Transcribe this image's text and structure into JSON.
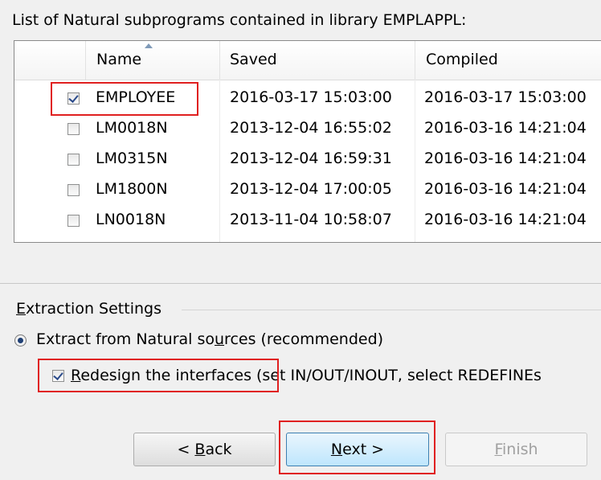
{
  "list": {
    "title": "List of Natural subprograms contained in library EMPLAPPL:",
    "columns": {
      "name": "Name",
      "saved": "Saved",
      "compiled": "Compiled"
    },
    "rows": [
      {
        "name": "EMPLOYEE",
        "saved": "2016-03-17 15:03:00",
        "compiled": "2016-03-17 15:03:00",
        "checked": true
      },
      {
        "name": "LM0018N",
        "saved": "2013-12-04 16:55:02",
        "compiled": "2016-03-16 14:21:04",
        "checked": false
      },
      {
        "name": "LM0315N",
        "saved": "2013-12-04 16:59:31",
        "compiled": "2016-03-16 14:21:04",
        "checked": false
      },
      {
        "name": "LM1800N",
        "saved": "2013-12-04 17:00:05",
        "compiled": "2016-03-16 14:21:04",
        "checked": false
      },
      {
        "name": "LN0018N",
        "saved": "2013-11-04 10:58:07",
        "compiled": "2016-03-16 14:21:04",
        "checked": false
      }
    ]
  },
  "settings": {
    "group_title_pre": "E",
    "group_title_post": "xtraction Settings",
    "radio_pre": "Extract from Natural so",
    "radio_accel": "u",
    "radio_post": "rces (recommended)",
    "redesign_accel": "R",
    "redesign_main": "edesign the interfaces",
    "redesign_rest": " (set IN/OUT/INOUT, select REDEFINEs"
  },
  "buttons": {
    "back_pre": "< ",
    "back_accel": "B",
    "back_post": "ack",
    "next_accel": "N",
    "next_post": "ext >",
    "finish_accel": "F",
    "finish_post": "inish"
  },
  "colors": {
    "highlight_box": "#e02020",
    "primary_button": "#bee6fd"
  }
}
